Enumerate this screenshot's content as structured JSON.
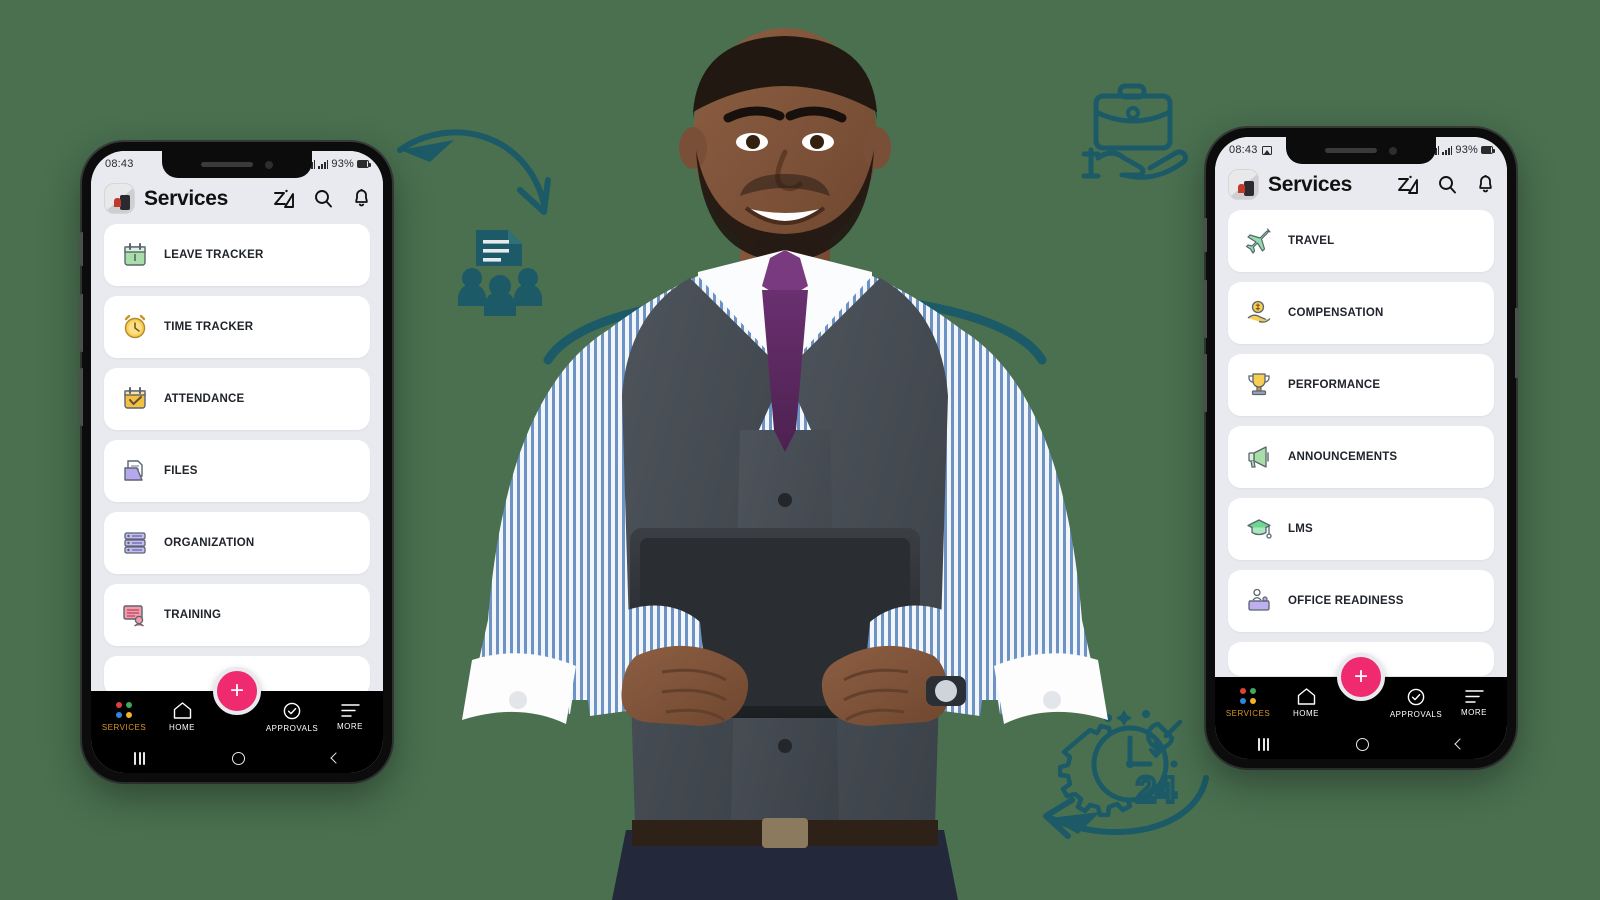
{
  "page": {
    "background_color": "#4a7050",
    "accent_pink": "#ef2a6e",
    "accent_teal": "#1b5a66",
    "active_nav_color": "#d8981f"
  },
  "decorations": [
    {
      "name": "team-document-icon",
      "label": "team document icon"
    },
    {
      "name": "briefcase-in-hand-icon",
      "label": "briefcase in hand icon"
    },
    {
      "name": "support-24-gear-clock-icon",
      "label": "24 hour support icon",
      "text": "24"
    },
    {
      "name": "curved-arrow-down-right",
      "label": "curved arrow pointing down right"
    },
    {
      "name": "curved-arrow-up-left",
      "label": "curved arrow pointing up left"
    },
    {
      "name": "teal-arc",
      "label": "teal arc behind person"
    }
  ],
  "hero": {
    "name": "businessman-with-tablet",
    "alt": "Smiling businessman in grey vest holding a tablet"
  },
  "phone_left": {
    "status_bar": {
      "time": "08:43",
      "battery": "93%",
      "has_image_icon": false
    },
    "header": {
      "title": "Services",
      "avatar": "user-avatar",
      "icons": [
        {
          "name": "brand-logo-icon",
          "glyph": "Zó"
        },
        {
          "name": "search-icon",
          "glyph": "search"
        },
        {
          "name": "notification-bell-icon",
          "glyph": "bell"
        }
      ]
    },
    "services": [
      {
        "label": "LEAVE TRACKER",
        "icon": "calendar-leave-icon",
        "icon_color": "#9fd89f"
      },
      {
        "label": "TIME TRACKER",
        "icon": "alarm-clock-icon",
        "icon_color": "#f5c542"
      },
      {
        "label": "ATTENDANCE",
        "icon": "calendar-check-icon",
        "icon_color": "#f2b93c"
      },
      {
        "label": "FILES",
        "icon": "folder-files-icon",
        "icon_color": "#b3a6e8"
      },
      {
        "label": "ORGANIZATION",
        "icon": "org-chart-icon",
        "icon_color": "#b3a6e8"
      },
      {
        "label": "TRAINING",
        "icon": "training-board-icon",
        "icon_color": "#f08ca0"
      }
    ],
    "fab": {
      "name": "add-button",
      "label": "+"
    },
    "bottom_nav": [
      {
        "label": "SERVICES",
        "icon": "four-dots-icon",
        "active": true
      },
      {
        "label": "HOME",
        "icon": "home-icon",
        "active": false
      },
      {
        "label": "APPROVALS",
        "icon": "check-circle-icon",
        "active": false
      },
      {
        "label": "MORE",
        "icon": "hamburger-menu-icon",
        "active": false
      }
    ],
    "system_nav": [
      {
        "name": "recents-button",
        "glyph": "|||"
      },
      {
        "name": "home-button",
        "glyph": "circle"
      },
      {
        "name": "back-button",
        "glyph": "chevron-left"
      }
    ]
  },
  "phone_right": {
    "status_bar": {
      "time": "08:43",
      "battery": "93%",
      "has_image_icon": true
    },
    "header": {
      "title": "Services",
      "avatar": "user-avatar",
      "icons": [
        {
          "name": "brand-logo-icon",
          "glyph": "Zó"
        },
        {
          "name": "search-icon",
          "glyph": "search"
        },
        {
          "name": "notification-bell-icon",
          "glyph": "bell"
        }
      ]
    },
    "services": [
      {
        "label": "TRAVEL",
        "icon": "airplane-icon",
        "icon_color": "#8fe0a8"
      },
      {
        "label": "COMPENSATION",
        "icon": "money-in-hand-icon",
        "icon_color": "#f5c542"
      },
      {
        "label": "PERFORMANCE",
        "icon": "trophy-icon",
        "icon_color": "#f5c542"
      },
      {
        "label": "ANNOUNCEMENTS",
        "icon": "megaphone-icon",
        "icon_color": "#9fd89f"
      },
      {
        "label": "LMS",
        "icon": "graduation-cap-icon",
        "icon_color": "#6ed68f"
      },
      {
        "label": "OFFICE READINESS",
        "icon": "office-desk-icon",
        "icon_color": "#b3a6e8"
      }
    ],
    "fab": {
      "name": "add-button",
      "label": "+"
    },
    "bottom_nav": [
      {
        "label": "SERVICES",
        "icon": "four-dots-icon",
        "active": true
      },
      {
        "label": "HOME",
        "icon": "home-icon",
        "active": false
      },
      {
        "label": "APPROVALS",
        "icon": "check-circle-icon",
        "active": false
      },
      {
        "label": "MORE",
        "icon": "hamburger-menu-icon",
        "active": false
      }
    ],
    "system_nav": [
      {
        "name": "recents-button",
        "glyph": "|||"
      },
      {
        "name": "home-button",
        "glyph": "circle"
      },
      {
        "name": "back-button",
        "glyph": "chevron-left"
      }
    ]
  }
}
